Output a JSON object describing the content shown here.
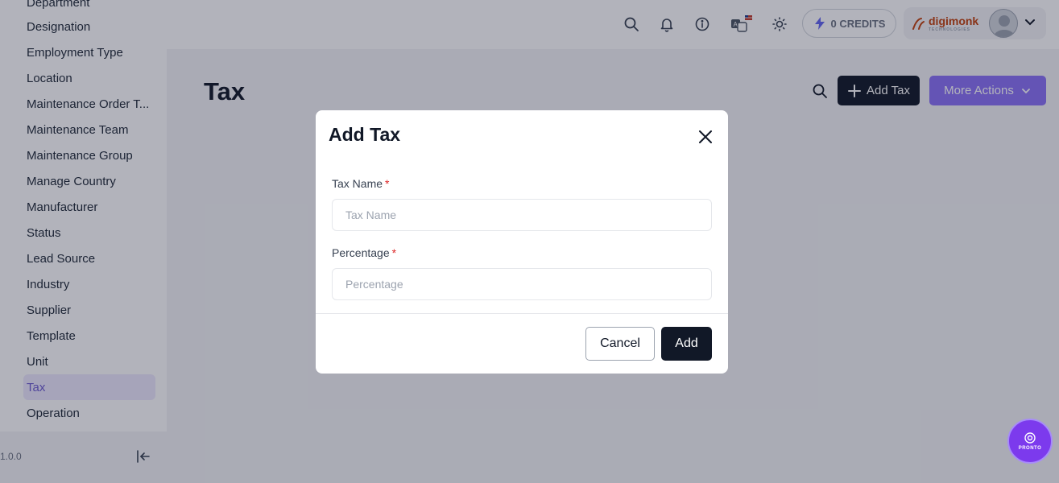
{
  "sidebar": {
    "items": [
      {
        "label": "Department"
      },
      {
        "label": "Designation"
      },
      {
        "label": "Employment Type"
      },
      {
        "label": "Location"
      },
      {
        "label": "Maintenance Order T..."
      },
      {
        "label": "Maintenance Team"
      },
      {
        "label": "Maintenance Group"
      },
      {
        "label": "Manage Country"
      },
      {
        "label": "Manufacturer"
      },
      {
        "label": "Status"
      },
      {
        "label": "Lead Source"
      },
      {
        "label": "Industry"
      },
      {
        "label": "Supplier"
      },
      {
        "label": "Template"
      },
      {
        "label": "Unit"
      },
      {
        "label": "Tax",
        "active": true
      },
      {
        "label": "Operation"
      }
    ],
    "version": "1.0.0"
  },
  "topbar": {
    "icons": [
      "search-icon",
      "bell-icon",
      "info-icon",
      "translate-icon",
      "sun-icon"
    ],
    "credits_label": "0 CREDITS",
    "brand_name": "digimonk",
    "brand_sub": "TECHNOLOGIES"
  },
  "page": {
    "title": "Tax",
    "add_button": "Add Tax",
    "more_actions": "More Actions"
  },
  "modal": {
    "title": "Add Tax",
    "fields": [
      {
        "label": "Tax Name",
        "required_mark": "*",
        "placeholder": "Tax Name",
        "value": ""
      },
      {
        "label": "Percentage",
        "required_mark": "*",
        "placeholder": "Percentage",
        "value": ""
      }
    ],
    "cancel_label": "Cancel",
    "submit_label": "Add"
  },
  "fab": {
    "label": "PRONTO"
  },
  "colors": {
    "accent": "#8b72f7",
    "dark_button": "#111827",
    "active_item": "#6d5bd0",
    "required": "#dc2626"
  }
}
